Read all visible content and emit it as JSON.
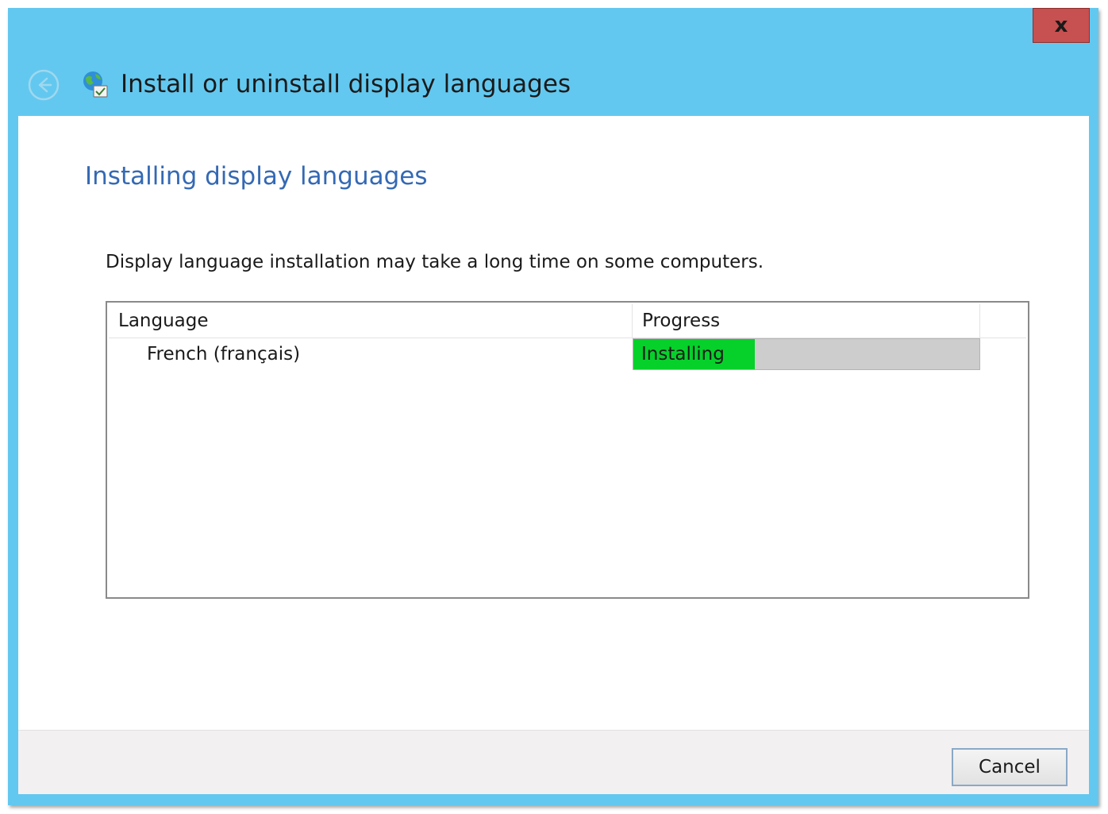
{
  "window": {
    "title": "Install or uninstall display languages",
    "close_glyph": "x",
    "chrome_color": "#63c8ef",
    "close_color": "#c75050"
  },
  "icons": {
    "back": "back-arrow-icon",
    "app": "language-globe-icon",
    "close": "close-icon"
  },
  "content": {
    "main_instruction": "Installing display languages",
    "description": "Display language installation may take a long time on some computers.",
    "accent_color": "#3469b4"
  },
  "list": {
    "columns": [
      "Language",
      "Progress"
    ],
    "rows": [
      {
        "language": "French (français)",
        "status": "Installing",
        "progress_fraction": 0.35,
        "progress_color": "#06d12a"
      }
    ]
  },
  "footer": {
    "cancel_label": "Cancel"
  }
}
